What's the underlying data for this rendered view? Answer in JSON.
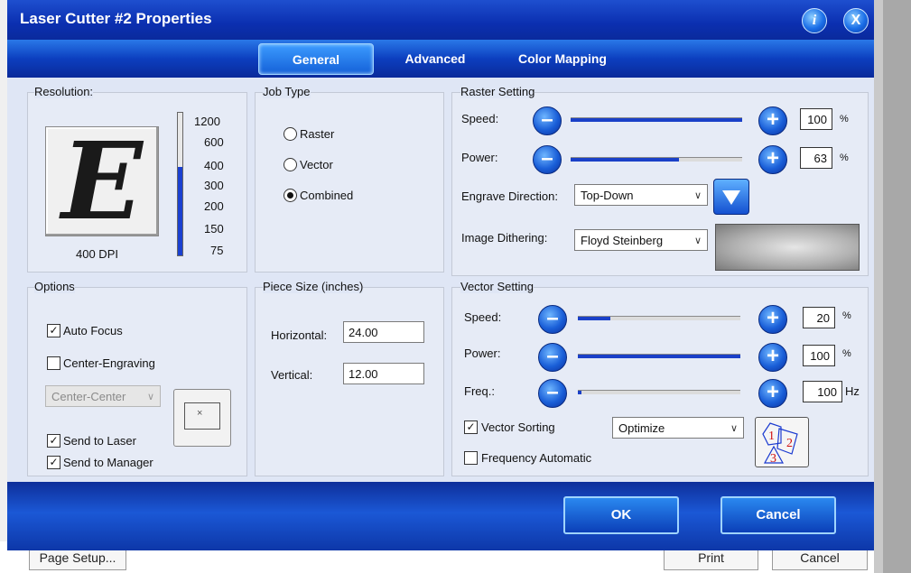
{
  "dialog": {
    "title": "Laser Cutter #2 Properties",
    "info_icon": "i",
    "close_icon": "X",
    "tabs": [
      {
        "label": "General",
        "active": true
      },
      {
        "label": "Advanced",
        "active": false
      },
      {
        "label": "Color Mapping",
        "active": false
      }
    ]
  },
  "resolution": {
    "label": "Resolution:",
    "preview_letter": "E",
    "current": "400 DPI",
    "ticks": [
      "1200",
      "600",
      "400",
      "300",
      "200",
      "150",
      "75"
    ],
    "level_fraction": 0.62
  },
  "job_type": {
    "label": "Job Type",
    "options": [
      "Raster",
      "Vector",
      "Combined"
    ],
    "selected": "Combined"
  },
  "raster": {
    "label": "Raster Setting",
    "speed_label": "Speed:",
    "speed_value": "100",
    "speed_fraction": 1.0,
    "power_label": "Power:",
    "power_value": "63",
    "power_fraction": 0.63,
    "unit": "%",
    "engrave_label": "Engrave Direction:",
    "engrave_value": "Top-Down",
    "dither_label": "Image Dithering:",
    "dither_value": "Floyd Steinberg"
  },
  "options": {
    "label": "Options",
    "auto_focus": "Auto Focus",
    "auto_focus_checked": true,
    "center_engraving": "Center-Engraving",
    "center_engraving_checked": false,
    "center_select": "Center-Center",
    "send_laser": "Send to Laser",
    "send_laser_checked": true,
    "send_manager": "Send to Manager",
    "send_manager_checked": true
  },
  "piece": {
    "label": "Piece Size (inches)",
    "horizontal_label": "Horizontal:",
    "horizontal_value": "24.00",
    "vertical_label": "Vertical:",
    "vertical_value": "12.00"
  },
  "vector": {
    "label": "Vector Setting",
    "speed_label": "Speed:",
    "speed_value": "20",
    "speed_fraction": 0.2,
    "power_label": "Power:",
    "power_value": "100",
    "power_fraction": 1.0,
    "freq_label": "Freq.:",
    "freq_value": "100",
    "freq_fraction": 0.01,
    "unit_percent": "%",
    "unit_hz": "Hz",
    "sorting_label": "Vector Sorting",
    "sorting_checked": true,
    "sorting_value": "Optimize",
    "freq_auto_label": "Frequency Automatic",
    "freq_auto_checked": false
  },
  "footer": {
    "ok": "OK",
    "cancel": "Cancel"
  },
  "background": {
    "page_setup": "Page Setup...",
    "print": "Print",
    "cancel": "Cancel"
  }
}
